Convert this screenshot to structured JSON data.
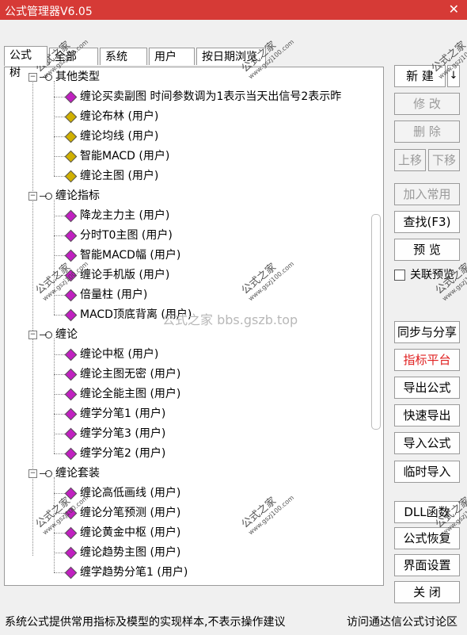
{
  "window": {
    "title": "公式管理器V6.05",
    "close_label": "✕"
  },
  "tabs": [
    "公式树",
    "全部",
    "系统",
    "用户",
    "按日期浏览"
  ],
  "tree": [
    {
      "type": "group",
      "label": "其他类型"
    },
    {
      "type": "item",
      "label": "缠论买卖副图  时间参数调为1表示当天出信号2表示昨",
      "color": "#c020c0"
    },
    {
      "type": "item",
      "label": "缠论布林  (用户)",
      "color": "#d0b000"
    },
    {
      "type": "item",
      "label": "缠论均线  (用户)",
      "color": "#d0b000"
    },
    {
      "type": "item",
      "label": "智能MACD  (用户)",
      "color": "#d0b000"
    },
    {
      "type": "item",
      "label": "缠论主图  (用户)",
      "color": "#d0b000"
    },
    {
      "type": "group",
      "label": "缠论指标"
    },
    {
      "type": "item",
      "label": "降龙主力主  (用户)",
      "color": "#c020c0"
    },
    {
      "type": "item",
      "label": "分时T0主图  (用户)",
      "color": "#c020c0"
    },
    {
      "type": "item",
      "label": "智能MACD幅  (用户)",
      "color": "#c020c0"
    },
    {
      "type": "item",
      "label": "缠论手机版  (用户)",
      "color": "#c020c0"
    },
    {
      "type": "item",
      "label": "倍量柱  (用户)",
      "color": "#c020c0"
    },
    {
      "type": "item",
      "label": "MACD顶底背离  (用户)",
      "color": "#c020c0"
    },
    {
      "type": "group",
      "label": "缠论"
    },
    {
      "type": "item",
      "label": "缠论中枢  (用户)",
      "color": "#c020c0"
    },
    {
      "type": "item",
      "label": "缠论主图无密  (用户)",
      "color": "#c020c0"
    },
    {
      "type": "item",
      "label": "缠论全能主图  (用户)",
      "color": "#c020c0"
    },
    {
      "type": "item",
      "label": "缠学分笔1  (用户)",
      "color": "#c020c0"
    },
    {
      "type": "item",
      "label": "缠学分笔3  (用户)",
      "color": "#c020c0"
    },
    {
      "type": "item",
      "label": "缠学分笔2  (用户)",
      "color": "#c020c0"
    },
    {
      "type": "group",
      "label": "缠论套装"
    },
    {
      "type": "item",
      "label": "缠论高低画线  (用户)",
      "color": "#c020c0"
    },
    {
      "type": "item",
      "label": "缠论分笔预测  (用户)",
      "color": "#c020c0"
    },
    {
      "type": "item",
      "label": "缠论黄金中枢  (用户)",
      "color": "#c020c0"
    },
    {
      "type": "item",
      "label": "缠论趋势主图  (用户)",
      "color": "#c020c0"
    },
    {
      "type": "item",
      "label": "缠学趋势分笔1  (用户)",
      "color": "#c020c0"
    }
  ],
  "buttons": {
    "new": "新  建",
    "new_arrow": "↓",
    "modify": "修  改",
    "delete": "删  除",
    "move_up": "上移",
    "move_down": "下移",
    "add_common": "加入常用",
    "find": "查找(F3)",
    "preview": "预  览",
    "sync_share": "同步与分享",
    "indicator_platform": "指标平台",
    "export_formula": "导出公式",
    "quick_export": "快速导出",
    "import_formula": "导入公式",
    "temp_import": "临时导入",
    "dll_function": "DLL函数",
    "restore_formula": "公式恢复",
    "ui_settings": "界面设置",
    "close": "关  闭"
  },
  "checkbox": {
    "label": "关联预览",
    "checked": false
  },
  "status": {
    "left": "系统公式提供常用指标及模型的实现样本,不表示操作建议",
    "right": "访问通达信公式讨论区"
  },
  "watermark": {
    "center": "公式之家 bbs.gszb.top",
    "stamp_title": "公式之家",
    "stamp_url": "www.gszj100.com"
  },
  "colors": {
    "title_bar": "#d63a36",
    "accent_red": "#e02020"
  }
}
